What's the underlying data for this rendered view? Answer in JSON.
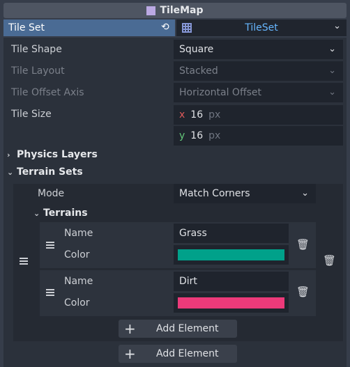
{
  "header": {
    "title": "TileMap",
    "icon": "tilemap-icon"
  },
  "tile_set": {
    "label": "Tile Set",
    "value": "TileSet",
    "reload_icon": "reload-icon",
    "dropdown_icon": "chevron-down-icon"
  },
  "properties": {
    "tile_shape": {
      "label": "Tile Shape",
      "value": "Square"
    },
    "tile_layout": {
      "label": "Tile Layout",
      "value": "Stacked"
    },
    "tile_offset_axis": {
      "label": "Tile Offset Axis",
      "value": "Horizontal Offset"
    },
    "tile_size": {
      "label": "Tile Size",
      "x_label": "x",
      "x_value": "16",
      "y_label": "y",
      "y_value": "16",
      "unit": "px"
    }
  },
  "sections": {
    "physics": "Physics Layers",
    "terrain_sets": "Terrain Sets",
    "terrains": "Terrains"
  },
  "terrain_set": {
    "mode_label": "Mode",
    "mode_value": "Match Corners",
    "terrains": [
      {
        "name_label": "Name",
        "name": "Grass",
        "color_label": "Color",
        "color": "#00a18a"
      },
      {
        "name_label": "Name",
        "name": "Dirt",
        "color_label": "Color",
        "color": "#ec3a7a"
      }
    ]
  },
  "buttons": {
    "add_element_inner": "Add Element",
    "add_element_outer": "Add Element"
  },
  "colors": {
    "accent": "#4a6b94",
    "link": "#66b6ff",
    "x_axis": "#e05a5a",
    "y_axis": "#63c77a"
  }
}
